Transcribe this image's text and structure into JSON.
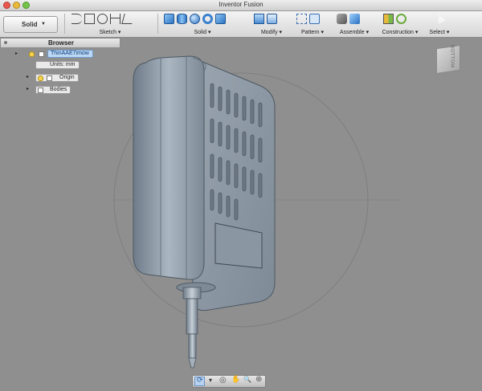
{
  "window": {
    "title": "Inventor Fusion"
  },
  "toolbar": {
    "workspace_label": "Solid",
    "groups": [
      {
        "label": "Sketch ▾"
      },
      {
        "label": "Solid ▾"
      },
      {
        "label": "Modify ▾"
      },
      {
        "label": "Pattern ▾"
      },
      {
        "label": "Assemble ▾"
      },
      {
        "label": "Construction ▾"
      },
      {
        "label": "Select ▾"
      }
    ]
  },
  "browser": {
    "title": "Browser",
    "items": [
      {
        "label": "ThinAAE7imow",
        "selected": true
      },
      {
        "label": "Units: mm"
      },
      {
        "label": "Origin"
      },
      {
        "label": "Bodies"
      }
    ]
  },
  "viewcube": {
    "face": "BOTTOM"
  },
  "colors": {
    "background": "#8f8f8f",
    "model": "#8c98a4",
    "selection": "#bcd7f3"
  },
  "icons": [
    "sketch-line-icon",
    "sketch-rect-icon",
    "sketch-circle-icon",
    "dimension-icon",
    "trim-icon",
    "box-icon",
    "cylinder-icon",
    "sphere-icon",
    "torus-icon",
    "press-pull-icon",
    "fillet-icon",
    "rectangular-pattern-icon",
    "circular-pattern-icon",
    "joint-icon",
    "ground-icon",
    "plane-icon",
    "axis-icon",
    "select-arrow-icon",
    "orbit-icon",
    "look-at-icon",
    "pan-icon",
    "zoom-icon",
    "zoom-fit-icon"
  ]
}
